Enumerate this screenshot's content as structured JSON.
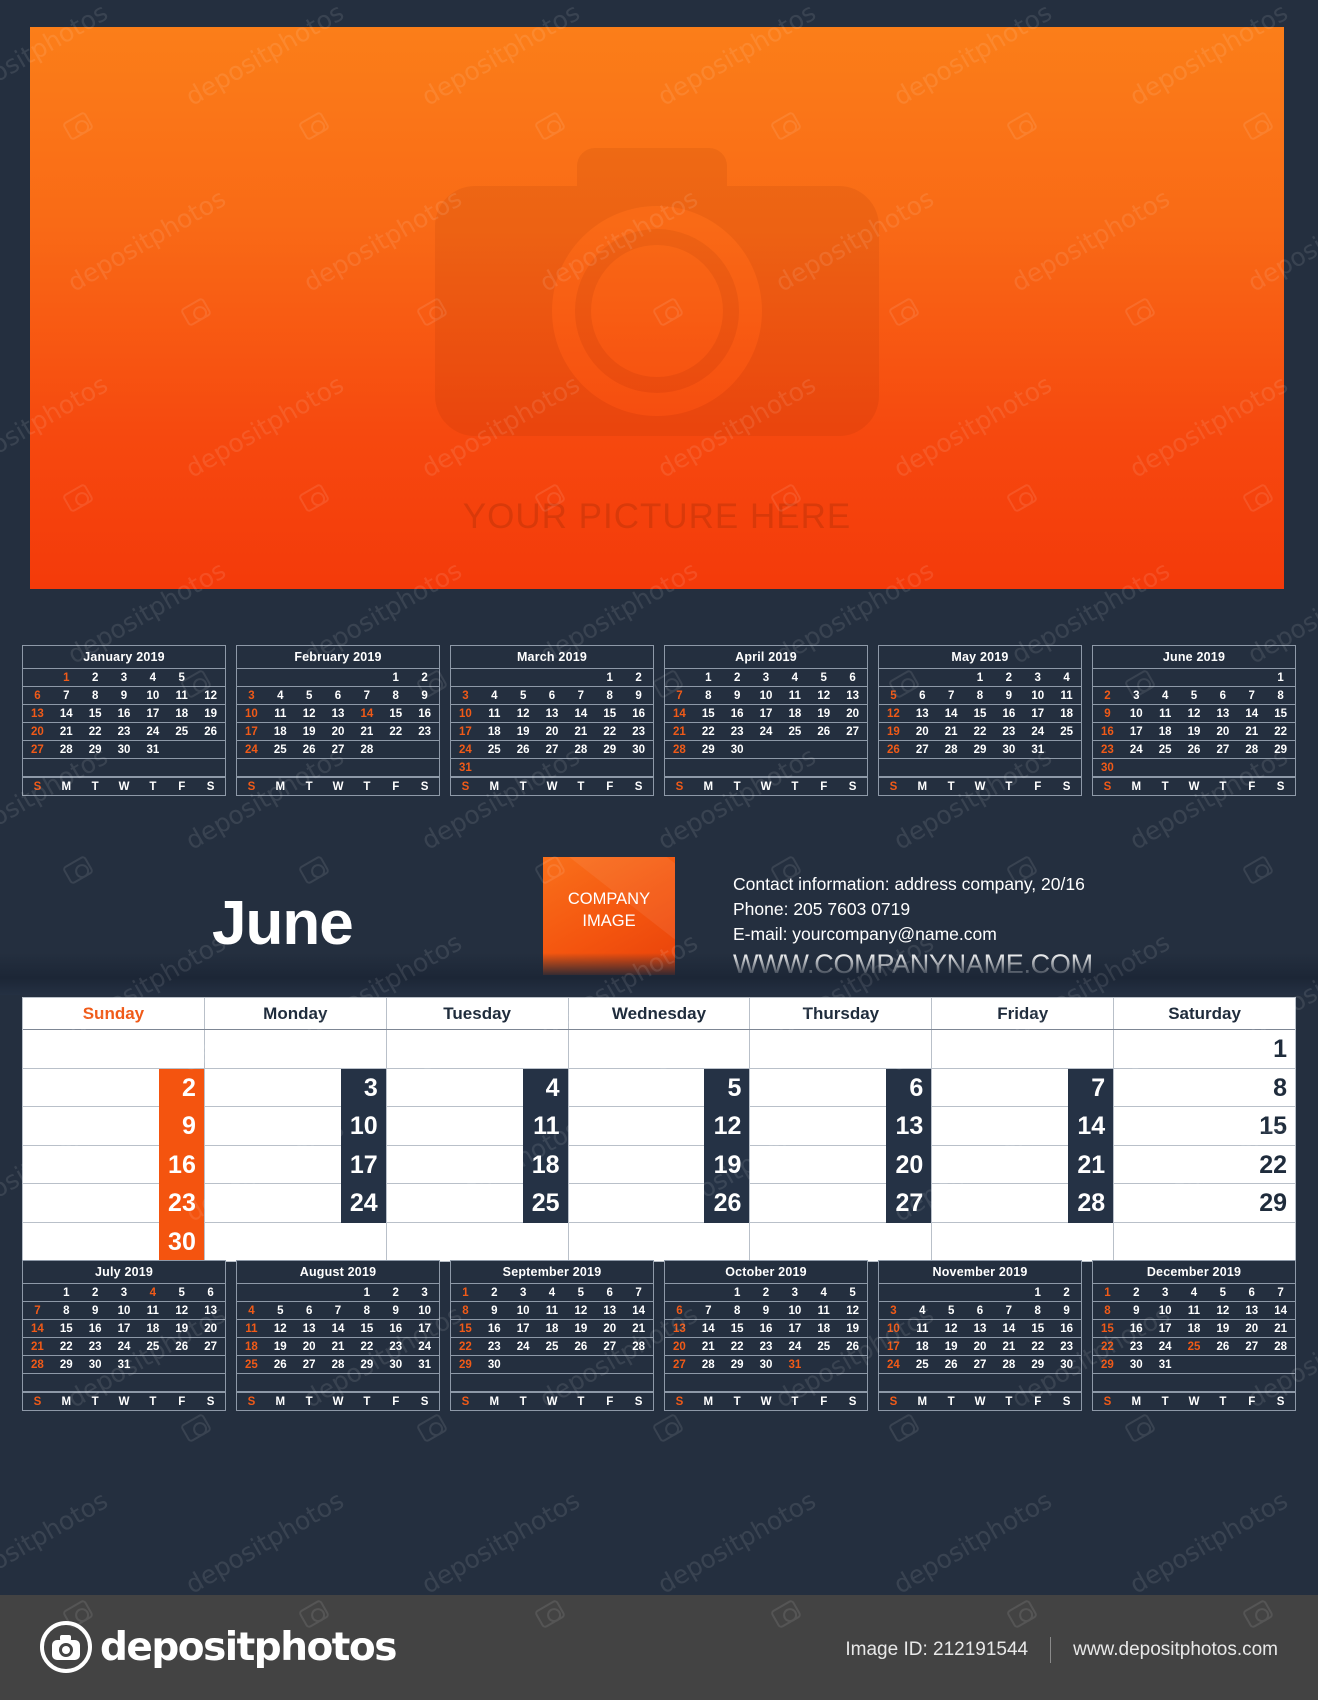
{
  "photo": {
    "placeholder_text": "YOUR PICTURE HERE",
    "icon": "camera-icon",
    "gradient_from": "#fb7e19",
    "gradient_to": "#f43a0a"
  },
  "accent_color": "#f05a18",
  "dark_color": "#242f3f",
  "month_title": "June",
  "company_image": {
    "line1": "COMPANY",
    "line2": "IMAGE"
  },
  "contact": {
    "address": "Contact information: address company, 20/16",
    "phone": "Phone: 205 7603 0719",
    "email": "E-mail: yourcompany@name.com",
    "website": "WWW.COMPANYNAME.COM"
  },
  "main_calendar": {
    "weekday_headers": [
      "Sunday",
      "Monday",
      "Tuesday",
      "Wednesday",
      "Thursday",
      "Friday",
      "Saturday"
    ],
    "weeks": [
      [
        null,
        null,
        null,
        null,
        null,
        null,
        {
          "d": "1",
          "style": "plain"
        }
      ],
      [
        {
          "d": "2",
          "style": "sun"
        },
        {
          "d": "3",
          "style": "dark"
        },
        {
          "d": "4",
          "style": "dark"
        },
        {
          "d": "5",
          "style": "dark"
        },
        {
          "d": "6",
          "style": "dark"
        },
        {
          "d": "7",
          "style": "dark"
        },
        {
          "d": "8",
          "style": "plain"
        }
      ],
      [
        {
          "d": "9",
          "style": "sun"
        },
        {
          "d": "10",
          "style": "dark"
        },
        {
          "d": "11",
          "style": "dark"
        },
        {
          "d": "12",
          "style": "dark"
        },
        {
          "d": "13",
          "style": "dark"
        },
        {
          "d": "14",
          "style": "dark"
        },
        {
          "d": "15",
          "style": "plain"
        }
      ],
      [
        {
          "d": "16",
          "style": "sun"
        },
        {
          "d": "17",
          "style": "dark"
        },
        {
          "d": "18",
          "style": "dark"
        },
        {
          "d": "19",
          "style": "dark"
        },
        {
          "d": "20",
          "style": "dark"
        },
        {
          "d": "21",
          "style": "dark"
        },
        {
          "d": "22",
          "style": "plain"
        }
      ],
      [
        {
          "d": "23",
          "style": "sun"
        },
        {
          "d": "24",
          "style": "dark"
        },
        {
          "d": "25",
          "style": "dark"
        },
        {
          "d": "26",
          "style": "dark"
        },
        {
          "d": "27",
          "style": "dark"
        },
        {
          "d": "28",
          "style": "dark"
        },
        {
          "d": "29",
          "style": "plain"
        }
      ],
      [
        {
          "d": "30",
          "style": "sun"
        },
        null,
        null,
        null,
        null,
        null,
        null
      ]
    ]
  },
  "mini_dow": [
    "S",
    "M",
    "T",
    "W",
    "T",
    "F",
    "S"
  ],
  "mini_calendars_top": [
    {
      "title": "January 2019",
      "weeks": [
        [
          "",
          "1",
          "2",
          "3",
          "4",
          "5",
          ""
        ],
        [
          "6",
          "7",
          "8",
          "9",
          "10",
          "11",
          "12"
        ],
        [
          "13",
          "14",
          "15",
          "16",
          "17",
          "18",
          "19"
        ],
        [
          "20",
          "21",
          "22",
          "23",
          "24",
          "25",
          "26"
        ],
        [
          "27",
          "28",
          "29",
          "30",
          "31",
          "",
          ""
        ],
        [
          "",
          "",
          "",
          "",
          "",
          "",
          ""
        ]
      ],
      "holidays": [
        "1"
      ]
    },
    {
      "title": "February 2019",
      "weeks": [
        [
          "",
          "",
          "",
          "",
          "",
          "1",
          "2"
        ],
        [
          "3",
          "4",
          "5",
          "6",
          "7",
          "8",
          "9"
        ],
        [
          "10",
          "11",
          "12",
          "13",
          "14",
          "15",
          "16"
        ],
        [
          "17",
          "18",
          "19",
          "20",
          "21",
          "22",
          "23"
        ],
        [
          "24",
          "25",
          "26",
          "27",
          "28",
          "",
          ""
        ],
        [
          "",
          "",
          "",
          "",
          "",
          "",
          ""
        ]
      ],
      "holidays": [
        "14"
      ]
    },
    {
      "title": "March 2019",
      "weeks": [
        [
          "",
          "",
          "",
          "",
          "",
          "1",
          "2"
        ],
        [
          "3",
          "4",
          "5",
          "6",
          "7",
          "8",
          "9"
        ],
        [
          "10",
          "11",
          "12",
          "13",
          "14",
          "15",
          "16"
        ],
        [
          "17",
          "18",
          "19",
          "20",
          "21",
          "22",
          "23"
        ],
        [
          "24",
          "25",
          "26",
          "27",
          "28",
          "29",
          "30"
        ],
        [
          "31",
          "",
          "",
          "",
          "",
          "",
          ""
        ]
      ],
      "holidays": []
    },
    {
      "title": "April 2019",
      "weeks": [
        [
          "",
          "1",
          "2",
          "3",
          "4",
          "5",
          "6"
        ],
        [
          "7",
          "8",
          "9",
          "10",
          "11",
          "12",
          "13"
        ],
        [
          "14",
          "15",
          "16",
          "17",
          "18",
          "19",
          "20"
        ],
        [
          "21",
          "22",
          "23",
          "24",
          "25",
          "26",
          "27"
        ],
        [
          "28",
          "29",
          "30",
          "",
          "",
          "",
          ""
        ],
        [
          "",
          "",
          "",
          "",
          "",
          "",
          ""
        ]
      ],
      "holidays": []
    },
    {
      "title": "May 2019",
      "weeks": [
        [
          "",
          "",
          "",
          "1",
          "2",
          "3",
          "4"
        ],
        [
          "5",
          "6",
          "7",
          "8",
          "9",
          "10",
          "11"
        ],
        [
          "12",
          "13",
          "14",
          "15",
          "16",
          "17",
          "18"
        ],
        [
          "19",
          "20",
          "21",
          "22",
          "23",
          "24",
          "25"
        ],
        [
          "26",
          "27",
          "28",
          "29",
          "30",
          "31",
          ""
        ],
        [
          "",
          "",
          "",
          "",
          "",
          "",
          ""
        ]
      ],
      "holidays": []
    },
    {
      "title": "June 2019",
      "weeks": [
        [
          "",
          "",
          "",
          "",
          "",
          "",
          "1"
        ],
        [
          "2",
          "3",
          "4",
          "5",
          "6",
          "7",
          "8"
        ],
        [
          "9",
          "10",
          "11",
          "12",
          "13",
          "14",
          "15"
        ],
        [
          "16",
          "17",
          "18",
          "19",
          "20",
          "21",
          "22"
        ],
        [
          "23",
          "24",
          "25",
          "26",
          "27",
          "28",
          "29"
        ],
        [
          "30",
          "",
          "",
          "",
          "",
          "",
          ""
        ]
      ],
      "holidays": []
    }
  ],
  "mini_calendars_bottom": [
    {
      "title": "July 2019",
      "weeks": [
        [
          "",
          "1",
          "2",
          "3",
          "4",
          "5",
          "6"
        ],
        [
          "7",
          "8",
          "9",
          "10",
          "11",
          "12",
          "13"
        ],
        [
          "14",
          "15",
          "16",
          "17",
          "18",
          "19",
          "20"
        ],
        [
          "21",
          "22",
          "23",
          "24",
          "25",
          "26",
          "27"
        ],
        [
          "28",
          "29",
          "30",
          "31",
          "",
          "",
          ""
        ],
        [
          "",
          "",
          "",
          "",
          "",
          "",
          ""
        ]
      ],
      "holidays": [
        "4"
      ]
    },
    {
      "title": "August 2019",
      "weeks": [
        [
          "",
          "",
          "",
          "",
          "1",
          "2",
          "3"
        ],
        [
          "4",
          "5",
          "6",
          "7",
          "8",
          "9",
          "10"
        ],
        [
          "11",
          "12",
          "13",
          "14",
          "15",
          "16",
          "17"
        ],
        [
          "18",
          "19",
          "20",
          "21",
          "22",
          "23",
          "24"
        ],
        [
          "25",
          "26",
          "27",
          "28",
          "29",
          "30",
          "31"
        ],
        [
          "",
          "",
          "",
          "",
          "",
          "",
          ""
        ]
      ],
      "holidays": []
    },
    {
      "title": "September 2019",
      "weeks": [
        [
          "1",
          "2",
          "3",
          "4",
          "5",
          "6",
          "7"
        ],
        [
          "8",
          "9",
          "10",
          "11",
          "12",
          "13",
          "14"
        ],
        [
          "15",
          "16",
          "17",
          "18",
          "19",
          "20",
          "21"
        ],
        [
          "22",
          "23",
          "24",
          "25",
          "26",
          "27",
          "28"
        ],
        [
          "29",
          "30",
          "",
          "",
          "",
          "",
          ""
        ],
        [
          "",
          "",
          "",
          "",
          "",
          "",
          ""
        ]
      ],
      "holidays": []
    },
    {
      "title": "October 2019",
      "weeks": [
        [
          "",
          "",
          "1",
          "2",
          "3",
          "4",
          "5"
        ],
        [
          "6",
          "7",
          "8",
          "9",
          "10",
          "11",
          "12"
        ],
        [
          "13",
          "14",
          "15",
          "16",
          "17",
          "18",
          "19"
        ],
        [
          "20",
          "21",
          "22",
          "23",
          "24",
          "25",
          "26"
        ],
        [
          "27",
          "28",
          "29",
          "30",
          "31",
          "",
          ""
        ],
        [
          "",
          "",
          "",
          "",
          "",
          "",
          ""
        ]
      ],
      "holidays": [
        "31"
      ]
    },
    {
      "title": "November 2019",
      "weeks": [
        [
          "",
          "",
          "",
          "",
          "",
          "1",
          "2"
        ],
        [
          "3",
          "4",
          "5",
          "6",
          "7",
          "8",
          "9"
        ],
        [
          "10",
          "11",
          "12",
          "13",
          "14",
          "15",
          "16"
        ],
        [
          "17",
          "18",
          "19",
          "20",
          "21",
          "22",
          "23"
        ],
        [
          "24",
          "25",
          "26",
          "27",
          "28",
          "29",
          "30"
        ],
        [
          "",
          "",
          "",
          "",
          "",
          "",
          ""
        ]
      ],
      "holidays": []
    },
    {
      "title": "December 2019",
      "weeks": [
        [
          "1",
          "2",
          "3",
          "4",
          "5",
          "6",
          "7"
        ],
        [
          "8",
          "9",
          "10",
          "11",
          "12",
          "13",
          "14"
        ],
        [
          "15",
          "16",
          "17",
          "18",
          "19",
          "20",
          "21"
        ],
        [
          "22",
          "23",
          "24",
          "25",
          "26",
          "27",
          "28"
        ],
        [
          "29",
          "30",
          "31",
          "",
          "",
          "",
          ""
        ],
        [
          "",
          "",
          "",
          "",
          "",
          "",
          ""
        ]
      ],
      "holidays": [
        "25"
      ]
    }
  ],
  "footer": {
    "brand": "depositphotos",
    "logo_icon": "camera-icon",
    "image_id": "Image ID: 212191544",
    "site": "www.depositphotos.com"
  },
  "watermark": {
    "text": "depositphotos",
    "icon": "camera-icon"
  }
}
